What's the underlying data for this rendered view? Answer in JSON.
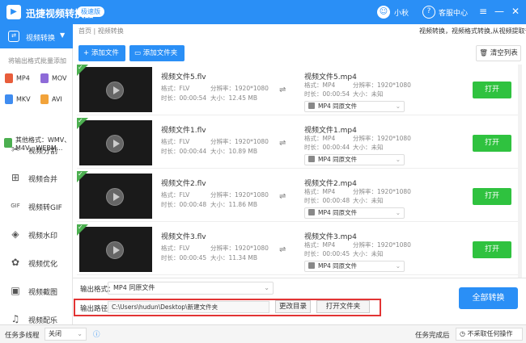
{
  "app": {
    "title": "迅捷视频转换器",
    "badge": "极速版",
    "user": "小秋",
    "service": "客服中心",
    "win_controls": [
      "≡",
      "—",
      "✕"
    ]
  },
  "sidebar": {
    "active_item": "视频转换",
    "hint": "将输出格式批量添加",
    "formats": [
      {
        "label": "MP4",
        "color": "#e85d3b"
      },
      {
        "label": "MOV",
        "color": "#8e6bd8"
      },
      {
        "label": "MKV",
        "color": "#3f8cf0"
      },
      {
        "label": "AVI",
        "color": "#f2a33a"
      }
    ],
    "other_formats": "其他格式：WMV、M4V、WEBM...",
    "items": [
      {
        "label": "视频分割",
        "icon": "scissors-icon"
      },
      {
        "label": "视频合并",
        "icon": "merge-icon"
      },
      {
        "label": "视频转GIF",
        "icon": "gif-icon"
      },
      {
        "label": "视频水印",
        "icon": "watermark-icon"
      },
      {
        "label": "视频优化",
        "icon": "optimize-icon"
      },
      {
        "label": "视频截图",
        "icon": "screenshot-icon"
      },
      {
        "label": "视频配乐",
        "icon": "music-icon"
      }
    ]
  },
  "header": {
    "breadcrumb": "首页 | 视频转换",
    "description": "视频转换，视频格式转换,从视频提取音频",
    "add_file": "添加文件",
    "add_folder": "添加文件夹",
    "clear": "清空列表"
  },
  "files": [
    {
      "name": "视频文件5.flv",
      "format": "FLV",
      "resolution": "1920*1080",
      "duration": "00:00:54",
      "size": "12.45 MB",
      "out_name": "视频文件5.mp4",
      "out_format": "MP4",
      "out_resolution": "1920*1080",
      "out_duration": "00:00:54",
      "out_size": "未知",
      "preset": "MP4 同原文件",
      "open": "打开"
    },
    {
      "name": "视频文件1.flv",
      "format": "FLV",
      "resolution": "1920*1080",
      "duration": "00:00:44",
      "size": "10.89 MB",
      "out_name": "视频文件1.mp4",
      "out_format": "MP4",
      "out_resolution": "1920*1080",
      "out_duration": "00:00:44",
      "out_size": "未知",
      "preset": "MP4 同原文件",
      "open": "打开"
    },
    {
      "name": "视频文件2.flv",
      "format": "FLV",
      "resolution": "1920*1080",
      "duration": "00:00:48",
      "size": "11.86 MB",
      "out_name": "视频文件2.mp4",
      "out_format": "MP4",
      "out_resolution": "1920*1080",
      "out_duration": "00:00:48",
      "out_size": "未知",
      "preset": "MP4 同原文件",
      "open": "打开"
    },
    {
      "name": "视频文件3.flv",
      "format": "FLV",
      "resolution": "1920*1080",
      "duration": "00:00:45",
      "size": "11.34 MB",
      "out_name": "视频文件3.mp4",
      "out_format": "MP4",
      "out_resolution": "1920*1080",
      "out_duration": "00:00:45",
      "out_size": "未知",
      "preset": "MP4 同原文件",
      "open": "打开"
    }
  ],
  "labels": {
    "format": "格式：",
    "resolution": "分辨率：",
    "duration": "时长：",
    "size": "大小："
  },
  "output": {
    "format_label": "输出格式：",
    "format_value": "MP4 同原文件",
    "path_label": "输出路径：",
    "path_value": "C:\\Users\\hudun\\Desktop\\新建文件夹",
    "change_dir": "更改目录",
    "open_folder": "打开文件夹",
    "convert_all": "全部转换"
  },
  "status": {
    "multithread_label": "任务多线程",
    "multithread_value": "关闭",
    "after_label": "任务完成后",
    "after_value": "不采取任何操作"
  }
}
